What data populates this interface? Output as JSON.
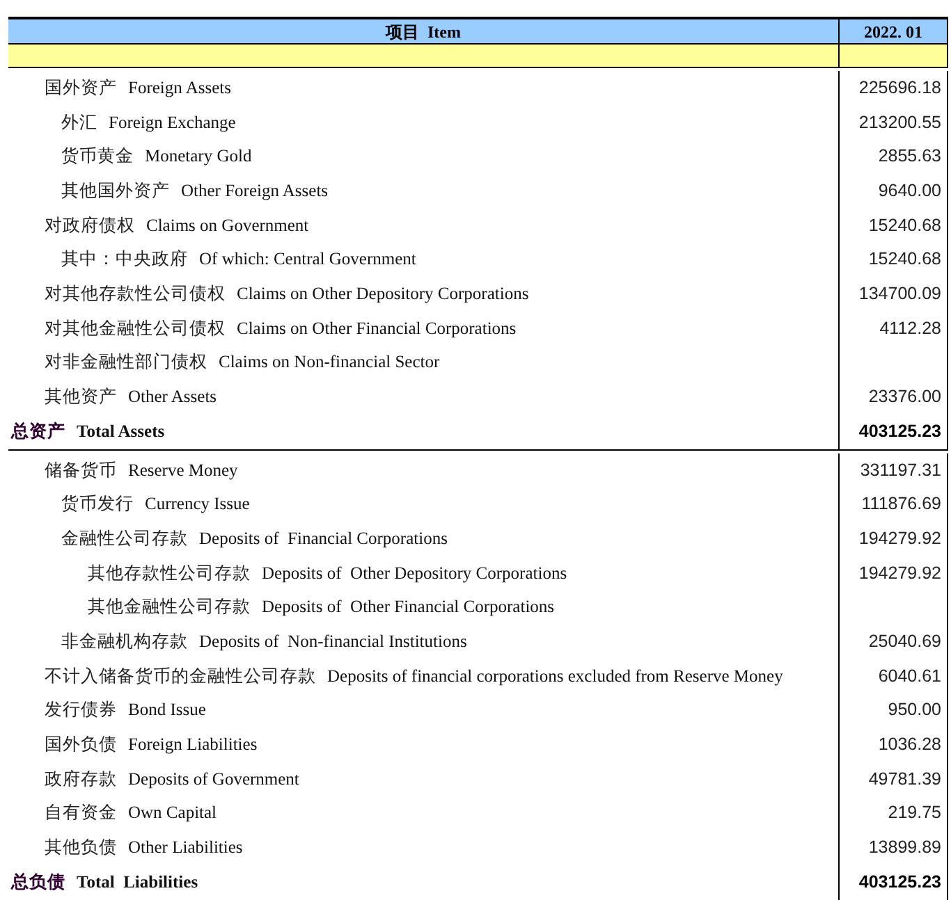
{
  "header": {
    "item_cn": "项目",
    "item_en": "Item",
    "period": "2022. 01"
  },
  "sections": [
    {
      "rows": [
        {
          "cn": "国外资产",
          "en": "Foreign Assets",
          "value": "225696.18",
          "children": [
            {
              "cn": "外汇",
              "en": "Foreign Exchange",
              "value": "213200.55"
            },
            {
              "cn": "货币黄金",
              "en": "Monetary Gold",
              "value": "2855.63"
            },
            {
              "cn": "其他国外资产",
              "en": "Other Foreign Assets",
              "value": "9640.00"
            }
          ]
        },
        {
          "cn": "对政府债权",
          "en": "Claims on Government",
          "value": "15240.68",
          "children": [
            {
              "cn": "其中：中央政府",
              "en": "Of which: Central Government",
              "value": "15240.68"
            }
          ]
        },
        {
          "cn": "对其他存款性公司债权",
          "en": "Claims on Other Depository Corporations",
          "value": "134700.09"
        },
        {
          "cn": "对其他金融性公司债权",
          "en": "Claims on Other Financial Corporations",
          "value": "4112.28"
        },
        {
          "cn": "对非金融性部门债权",
          "en": "Claims on Non-financial Sector"
        },
        {
          "cn": "其他资产",
          "en": "Other Assets",
          "value": "23376.00"
        }
      ],
      "total": {
        "cn": "总资产",
        "en": "Total Assets",
        "value": "403125.23"
      }
    },
    {
      "rows": [
        {
          "cn": "储备货币",
          "en": "Reserve Money",
          "value": "331197.31",
          "children": [
            {
              "cn": "货币发行",
              "en": "Currency Issue",
              "value": "111876.69"
            },
            {
              "cn": "金融性公司存款",
              "en": "Deposits of  Financial Corporations",
              "value": "194279.92",
              "children": [
                {
                  "cn": "其他存款性公司存款",
                  "en": "Deposits of  Other Depository Corporations",
                  "value": "194279.92"
                },
                {
                  "cn": "其他金融性公司存款",
                  "en": "Deposits of  Other Financial Corporations"
                }
              ]
            },
            {
              "cn": "非金融机构存款",
              "en": "Deposits of  Non-financial Institutions",
              "value": "25040.69"
            }
          ]
        },
        {
          "cn": "不计入储备货币的金融性公司存款",
          "en": "Deposits of financial corporations excluded from Reserve Money",
          "value": "6040.61"
        },
        {
          "cn": "发行债券",
          "en": "Bond Issue",
          "value": "950.00"
        },
        {
          "cn": "国外负债",
          "en": "Foreign Liabilities",
          "value": "1036.28"
        },
        {
          "cn": "政府存款",
          "en": "Deposits of Government",
          "value": "49781.39"
        },
        {
          "cn": "自有资金",
          "en": "Own Capital",
          "value": "219.75"
        },
        {
          "cn": "其他负债",
          "en": "Other Liabilities",
          "value": "13899.89"
        }
      ],
      "total": {
        "cn": "总负债",
        "en": "Total  Liabilities",
        "value": "403125.23"
      }
    }
  ]
}
